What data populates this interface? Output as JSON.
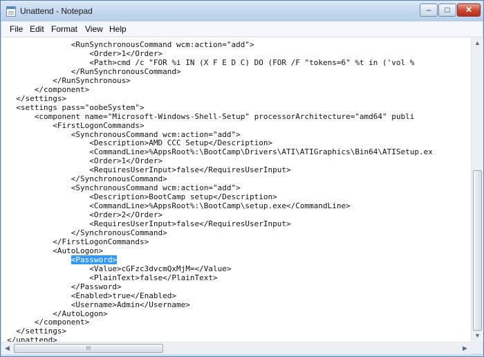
{
  "window": {
    "title": "Unattend - Notepad"
  },
  "title_buttons": {
    "minimize": "–",
    "maximize": "□",
    "close": "✕"
  },
  "menu": [
    "File",
    "Edit",
    "Format",
    "View",
    "Help"
  ],
  "editor": {
    "lines": [
      "              <RunSynchronousCommand wcm:action=\"add\">",
      "                  <Order>1</Order>",
      "                  <Path>cmd /c \"FOR %i IN (X F E D C) DO (FOR /F \"tokens=6\" %t in ('vol %",
      "              </RunSynchronousCommand>",
      "          </RunSynchronous>",
      "      </component>",
      "  </settings>",
      "  <settings pass=\"oobeSystem\">",
      "      <component name=\"Microsoft-Windows-Shell-Setup\" processorArchitecture=\"amd64\" publi",
      "          <FirstLogonCommands>",
      "              <SynchronousCommand wcm:action=\"add\">",
      "                  <Description>AMD CCC Setup</Description>",
      "                  <CommandLine>%AppsRoot%:\\BootCamp\\Drivers\\ATI\\ATIGraphics\\Bin64\\ATISetup.ex",
      "                  <Order>1</Order>",
      "                  <RequiresUserInput>false</RequiresUserInput>",
      "              </SynchronousCommand>",
      "              <SynchronousCommand wcm:action=\"add\">",
      "                  <Description>BootCamp setup</Description>",
      "                  <CommandLine>%AppsRoot%:\\BootCamp\\setup.exe</CommandLine>",
      "                  <Order>2</Order>",
      "                  <RequiresUserInput>false</RequiresUserInput>",
      "              </SynchronousCommand>",
      "          </FirstLogonCommands>",
      "          <AutoLogon>",
      "              <Password>",
      "                  <Value>cGFzc3dvcmQxMjM=</Value>",
      "                  <PlainText>false</PlainText>",
      "              </Password>",
      "              <Enabled>true</Enabled>",
      "              <Username>Admin</Username>",
      "          </AutoLogon>",
      "      </component>",
      "  </settings>",
      "</unattend>"
    ],
    "selection": {
      "line_index": 24,
      "text": "<Password>"
    }
  },
  "scrollbars": {
    "vertical": {
      "up_arrow": "▲",
      "down_arrow": "▼",
      "thumb_grip": "≡"
    },
    "horizontal": {
      "left_arrow": "◀",
      "right_arrow": "▶",
      "thumb_grip": "III"
    }
  }
}
